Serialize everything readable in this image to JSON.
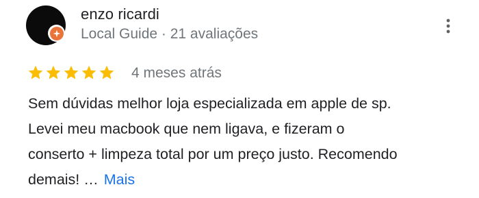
{
  "reviewer": {
    "name": "enzo ricardi",
    "meta": "Local Guide · 21 avaliações",
    "avatar_color": "#0b0b0b",
    "badge_color": "#e8743b"
  },
  "menu": {
    "icon": "more-vertical-icon"
  },
  "rating": {
    "stars": 5,
    "max": 5,
    "star_color": "#fbbc04"
  },
  "review": {
    "date": "4 meses atrás",
    "lines": [
      "Sem dúvidas melhor loja especializada em apple de sp.",
      "Levei meu macbook que nem ligava, e fizeram o",
      "conserto + limpeza total por um preço justo. Recomendo",
      "demais! …"
    ],
    "more_label": "Mais",
    "link_color": "#1a73e8"
  }
}
